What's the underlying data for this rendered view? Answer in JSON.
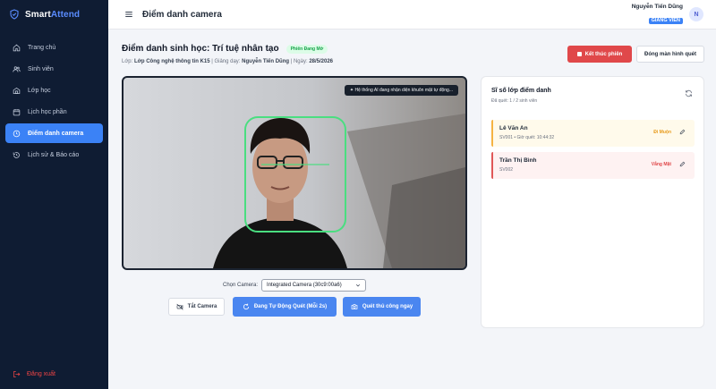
{
  "app": {
    "brand": "SmartAttend",
    "brand_left": "Smart",
    "brand_right": "Attend"
  },
  "sidebar": {
    "items": [
      {
        "label": "Trang chủ",
        "icon": "home-icon"
      },
      {
        "label": "Sinh viên",
        "icon": "users-icon"
      },
      {
        "label": "Lớp học",
        "icon": "classroom-icon"
      },
      {
        "label": "Lịch học phần",
        "icon": "calendar-icon"
      },
      {
        "label": "Điểm danh camera",
        "icon": "clock-icon",
        "active": true
      },
      {
        "label": "Lịch sử & Báo cáo",
        "icon": "history-icon"
      }
    ],
    "logout": "Đăng xuất"
  },
  "header": {
    "title": "Điểm danh camera"
  },
  "user": {
    "name": "Nguyễn Tiến Dũng",
    "role": "GIẢNG VIÊN",
    "initial": "N"
  },
  "session": {
    "title": "Điểm danh sinh học: Trí tuệ nhân tạo",
    "status": "Phiên Đang Mở",
    "class_label": "Lớp:",
    "class_value": "Lớp Công nghệ thông tin K15",
    "teacher_label": "Giảng dạy:",
    "teacher_value": "Nguyễn Tiến Dũng",
    "date_label": "Ngày:",
    "date_value": "28/5/2026"
  },
  "actions": {
    "end_session": "Kết thúc phiên",
    "close_screen": "Đóng màn hình quét"
  },
  "camera": {
    "ai_status": "Hệ thống AI đang nhận diện khuôn mặt tự động...",
    "select_label": "Chọn Camera:",
    "selected": "Integrated Camera (30c9:00a6)"
  },
  "controls": {
    "camera_off": "Tắt Camera",
    "auto_scan": "Đang Tự Động Quét (Mỗi 2s)",
    "manual_scan": "Quét thủ công ngay"
  },
  "panel": {
    "title": "Sĩ số lớp điểm danh",
    "subtitle": "Đã quét: 1 / 2 sinh viên",
    "students": [
      {
        "name": "Lê Văn An",
        "meta": "SV001 • Giờ quét: 10:44:32",
        "status": "Đi Muộn"
      },
      {
        "name": "Trần Thị Bình",
        "meta": "SV002",
        "status": "Vắng Mặt"
      }
    ]
  },
  "colors": {
    "sidebar_bg": "#0f1c33",
    "accent": "#3b82f6",
    "danger": "#e0484a",
    "late": "#e79a1b",
    "face_box": "#4ade80"
  }
}
